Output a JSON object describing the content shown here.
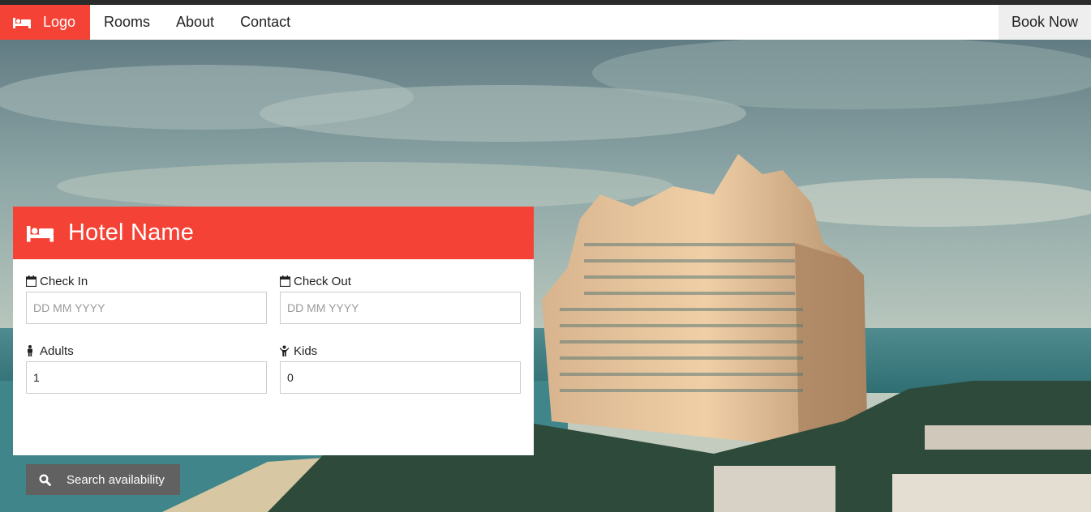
{
  "navbar": {
    "logo_label": "Logo",
    "logo_icon": "bed-icon",
    "items": [
      {
        "label": "Rooms"
      },
      {
        "label": "About"
      },
      {
        "label": "Contact"
      }
    ],
    "book_label": "Book Now"
  },
  "card": {
    "title": "Hotel Name",
    "title_icon": "bed-icon",
    "check_in": {
      "label": "Check In",
      "placeholder": "DD MM YYYY",
      "icon": "calendar-icon"
    },
    "check_out": {
      "label": "Check Out",
      "placeholder": "DD MM YYYY",
      "icon": "calendar-icon"
    },
    "adults": {
      "label": "Adults",
      "value": "1",
      "icon": "male-icon"
    },
    "kids": {
      "label": "Kids",
      "value": "0",
      "icon": "child-icon"
    },
    "search_label": "Search availability",
    "search_icon": "search-icon"
  },
  "colors": {
    "accent": "#f44336",
    "button": "#616161",
    "nav_bg": "#ffffff",
    "book_bg": "#eeeeee"
  }
}
